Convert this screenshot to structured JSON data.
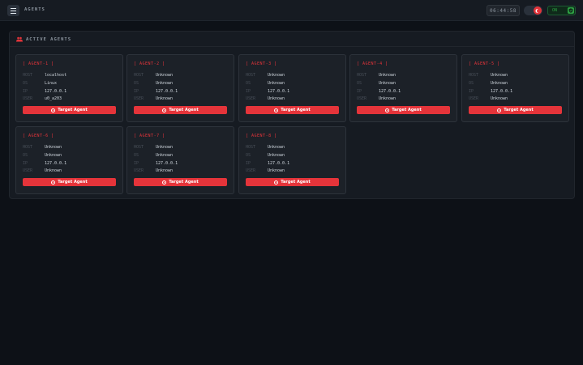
{
  "header": {
    "title": "AGENTS",
    "clock": "06:44:58",
    "connection_label": "ON"
  },
  "panel": {
    "title": "ACTIVE AGENTS"
  },
  "labels": {
    "host": "HOST",
    "os": "OS",
    "ip": "IP",
    "user": "USER",
    "target_button": "Target Agent"
  },
  "agents": [
    {
      "name": "[ AGENT-1 ]",
      "host": "localhost",
      "os": "Linux",
      "ip": "127.0.0.1",
      "user": "u0_a203"
    },
    {
      "name": "[ AGENT-2 ]",
      "host": "Unknown",
      "os": "Unknown",
      "ip": "127.0.0.1",
      "user": "Unknown"
    },
    {
      "name": "[ AGENT-3 ]",
      "host": "Unknown",
      "os": "Unknown",
      "ip": "127.0.0.1",
      "user": "Unknown"
    },
    {
      "name": "[ AGENT-4 ]",
      "host": "Unknown",
      "os": "Unknown",
      "ip": "127.0.0.1",
      "user": "Unknown"
    },
    {
      "name": "[ AGENT-5 ]",
      "host": "Unknown",
      "os": "Unknown",
      "ip": "127.0.0.1",
      "user": "Unknown"
    },
    {
      "name": "[ AGENT-6 ]",
      "host": "Unknown",
      "os": "Unknown",
      "ip": "127.0.0.1",
      "user": "Unknown"
    },
    {
      "name": "[ AGENT-7 ]",
      "host": "Unknown",
      "os": "Unknown",
      "ip": "127.0.0.1",
      "user": "Unknown"
    },
    {
      "name": "[ AGENT-8 ]",
      "host": "Unknown",
      "os": "Unknown",
      "ip": "127.0.0.1",
      "user": "Unknown"
    }
  ],
  "icons": {
    "menu": "hamburger-menu-icon",
    "theme": "moon-icon",
    "connection": "shield-check-icon",
    "panel": "users-icon",
    "target": "crosshair-icon"
  },
  "colors": {
    "accent": "#e5343a",
    "background": "#0d1117",
    "panel": "#161b22",
    "card": "#1c2128",
    "connected": "#2ea043"
  }
}
